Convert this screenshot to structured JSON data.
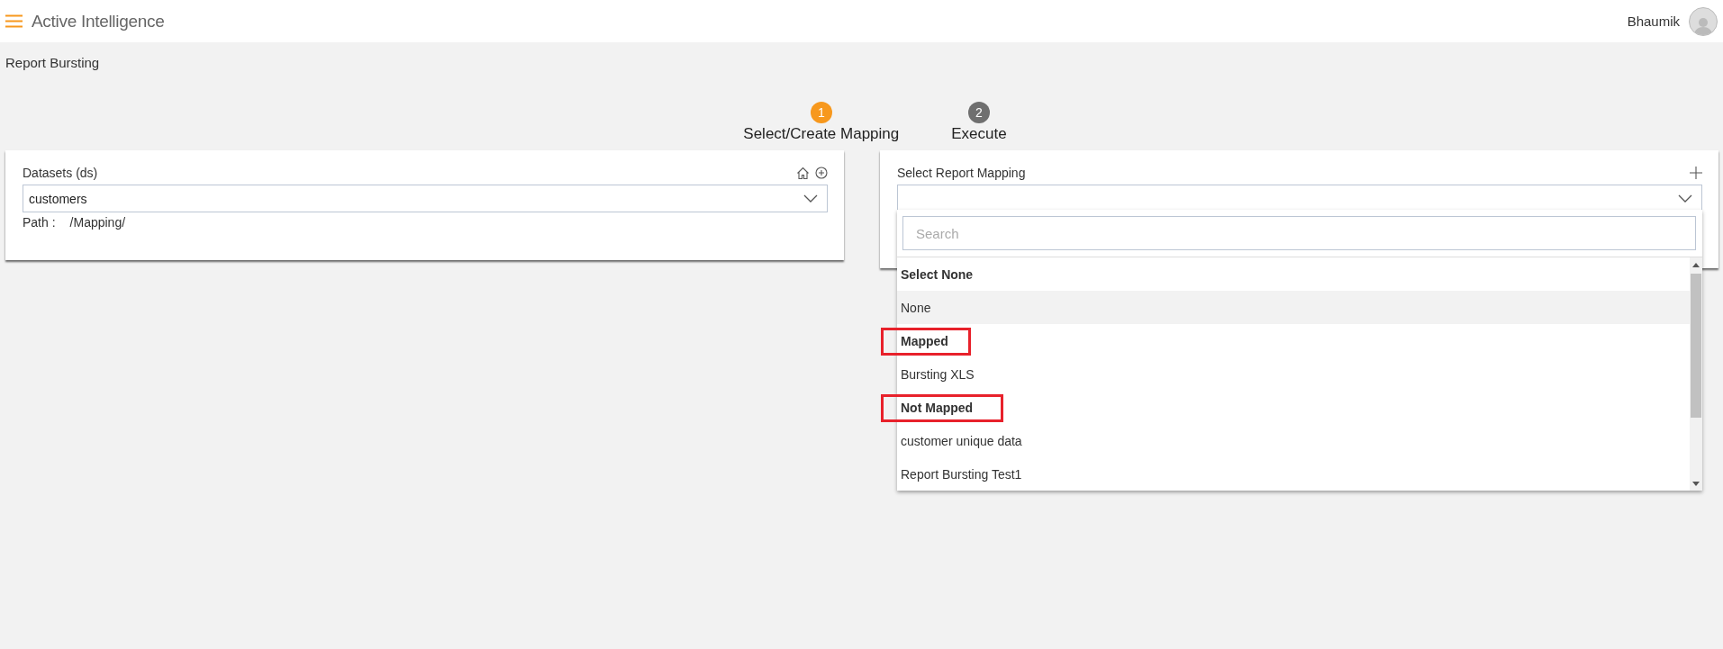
{
  "header": {
    "app_title": "Active Intelligence",
    "user_name": "Bhaumik"
  },
  "page_title": "Report Bursting",
  "steps": [
    {
      "number": "1",
      "label": "Select/Create Mapping",
      "selected": true
    },
    {
      "number": "2",
      "label": "Execute",
      "selected": false
    }
  ],
  "datasets_panel": {
    "label": "Datasets (ds)",
    "value": "customers",
    "path_label": "Path :",
    "path_value": "/Mapping/"
  },
  "mapping_panel": {
    "label": "Select Report Mapping",
    "search": {
      "placeholder": "Search"
    },
    "options": [
      {
        "kind": "group",
        "label": "Select None",
        "hovered": false,
        "annotated": false
      },
      {
        "kind": "option",
        "label": "None",
        "hovered": true,
        "annotated": false
      },
      {
        "kind": "group",
        "label": "Mapped",
        "hovered": false,
        "annotated": true
      },
      {
        "kind": "option",
        "label": "Bursting XLS",
        "hovered": false,
        "annotated": false
      },
      {
        "kind": "group",
        "label": "Not Mapped",
        "hovered": false,
        "annotated": true
      },
      {
        "kind": "option",
        "label": "customer unique data",
        "hovered": false,
        "annotated": false
      },
      {
        "kind": "option",
        "label": "Report Bursting Test1",
        "hovered": false,
        "annotated": false
      }
    ]
  }
}
